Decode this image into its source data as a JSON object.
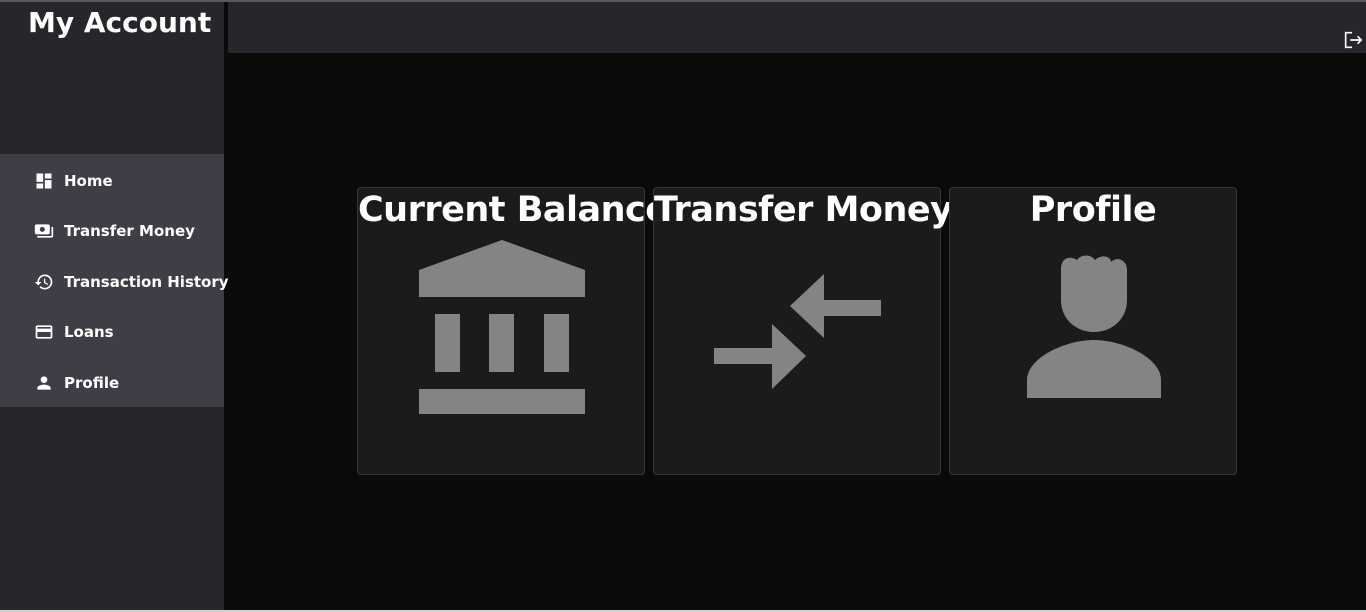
{
  "sidebar": {
    "brand": "My Account",
    "items": [
      {
        "label": "Home",
        "icon": "dashboard-icon"
      },
      {
        "label": "Transfer Money",
        "icon": "money-icon"
      },
      {
        "label": "Transaction History",
        "icon": "history-icon"
      },
      {
        "label": "Loans",
        "icon": "credit-card-icon"
      },
      {
        "label": "Profile",
        "icon": "person-icon"
      }
    ]
  },
  "header": {
    "logout_icon": "logout-icon"
  },
  "cards": [
    {
      "title": "Current Balance",
      "icon": "bank-icon"
    },
    {
      "title": "Transfer Money",
      "icon": "swap-arrows-icon"
    },
    {
      "title": "Profile",
      "icon": "person-icon"
    }
  ],
  "colors": {
    "background": "#0b0a09",
    "sidebar": "#27262b",
    "nav_panel": "#3f3e46",
    "card": "#1d1b1a",
    "icon_gray": "#858483"
  }
}
